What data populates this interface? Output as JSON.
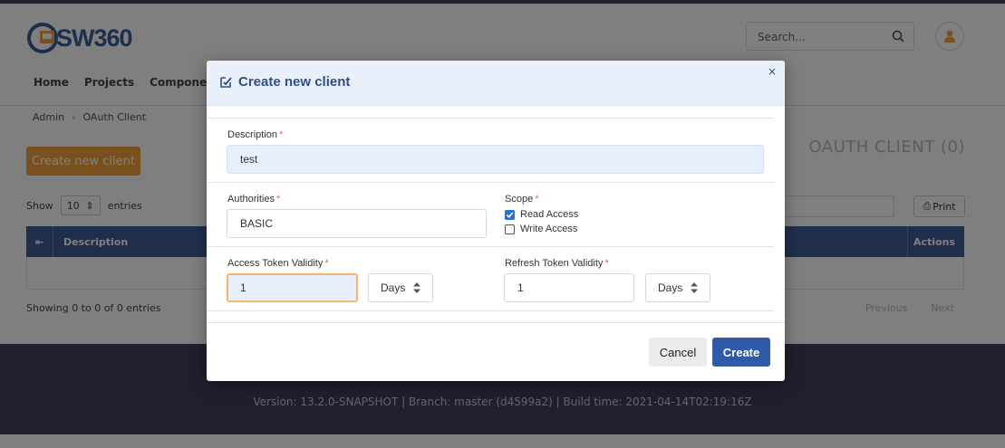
{
  "app": {
    "logo_text": "SW360",
    "search_placeholder": "Search...",
    "nav": [
      "Home",
      "Projects",
      "Components"
    ],
    "breadcrumb": [
      "Admin",
      "OAuth Client"
    ],
    "create_button": "Create new client",
    "page_title": "OAUTH CLIENT (0)",
    "show_label": "Show",
    "show_value": "10",
    "entries_label": "entries",
    "print_label": "Print",
    "table_headers": [
      "Description",
      "Actions"
    ],
    "showing_text": "Showing 0 to 0 of 0 entries",
    "pager": [
      "Previous",
      "Next"
    ],
    "footer_version": "Version: 13.2.0-SNAPSHOT | Branch: master (d4599a2) | Build time: 2021-04-14T02:19:16Z"
  },
  "modal": {
    "title": "Create new client",
    "close": "×",
    "description_label": "Description",
    "description_value": "test",
    "authorities_label": "Authorities",
    "authorities_value": "BASIC",
    "scope_label": "Scope",
    "scope_options": [
      {
        "label": "Read Access",
        "checked": true
      },
      {
        "label": "Write Access",
        "checked": false
      }
    ],
    "access_label": "Access Token Validity",
    "access_value": "1",
    "access_unit": "Days",
    "refresh_label": "Refresh Token Validity",
    "refresh_value": "1",
    "refresh_unit": "Days",
    "required_mark": "*",
    "cancel_label": "Cancel",
    "create_label": "Create"
  },
  "colors": {
    "brand": "#3f5e96",
    "accent": "#f4a23d",
    "primary_button": "#2f5aa8",
    "header_bar": "#3f3e5c"
  }
}
